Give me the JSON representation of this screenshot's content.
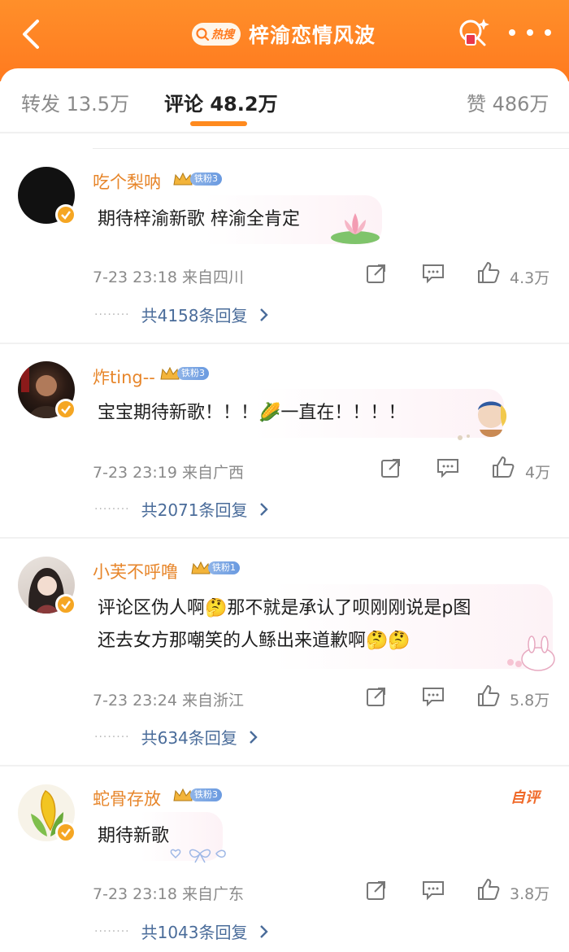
{
  "header": {
    "hot_badge": "热搜",
    "title": "梓渝恋情风波",
    "bg_color": "#ff7a1f"
  },
  "tabs": {
    "forward": "转发 13.5万",
    "comment": "评论 48.2万",
    "like": "赞 486万"
  },
  "comments": [
    {
      "name": "吃个梨呐",
      "fan_level": "铁粉3",
      "text": "期待梓渝新歌 梓渝全肯定",
      "time": "7-23 23:18 来自四川",
      "likes": "4.3万",
      "replies": "共4158条回复",
      "avatar": "black-circle"
    },
    {
      "name": "炸ting--",
      "fan_level": "铁粉3",
      "text": "宝宝期待新歌！！！🌽一直在！！！！",
      "time": "7-23 23:19 来自广西",
      "likes": "4万",
      "replies": "共2071条回复",
      "avatar": "man-portrait"
    },
    {
      "name": "小芙不呼噜",
      "fan_level": "铁粉1",
      "text_line1": "评论区伪人啊🤔那不就是承认了呗刚刚说是p图",
      "text_line2": "还去女方那嘲笑的人鲧出来道歉啊🤔🤔",
      "time": "7-23 23:24 来自浙江",
      "likes": "5.8万",
      "replies": "共634条回复",
      "avatar": "girl-portrait"
    },
    {
      "name": "蛇骨存放",
      "fan_level": "铁粉3",
      "text": "期待新歌",
      "time": "7-23 23:18 来自广东",
      "likes": "3.8万",
      "replies": "共1043条回复",
      "self_tag": "自评",
      "avatar": "corn"
    }
  ],
  "icons": {
    "back": "back-chevron-icon",
    "search_person": "search-person-icon",
    "more": "more-dots-icon",
    "forward": "share-arrow-icon",
    "comment": "comment-bubble-icon",
    "like": "thumb-up-icon",
    "chevron_right": "chevron-right-icon"
  }
}
